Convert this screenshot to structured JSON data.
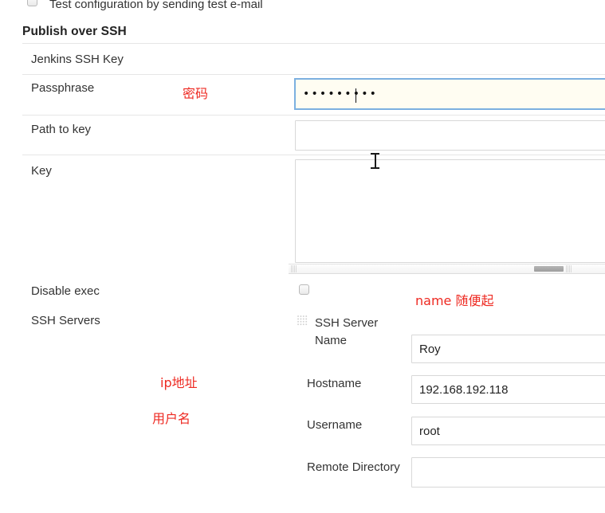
{
  "form": {
    "test_config_checkbox_label": "Test configuration by sending test e-mail",
    "section_title": "Publish over SSH",
    "fields": {
      "jenkins_ssh_key_label": "Jenkins SSH Key",
      "passphrase_label": "Passphrase",
      "passphrase_value_masked": "•••••••••",
      "path_to_key_label": "Path to key",
      "path_to_key_value": "",
      "key_label": "Key",
      "key_value": "",
      "disable_exec_label": "Disable exec",
      "ssh_servers_label": "SSH Servers"
    },
    "ssh_server": {
      "name_label": "SSH Server Name",
      "name_value": "Roy",
      "hostname_label": "Hostname",
      "hostname_value": "192.168.192.118",
      "username_label": "Username",
      "username_value": "root",
      "remote_directory_label": "Remote Directory",
      "remote_directory_value": ""
    }
  },
  "annotations": {
    "passphrase": "密码",
    "server_name": "name 随便起",
    "ip_address": "ip地址",
    "username": "用户名"
  },
  "colors": {
    "annotation_red": "#ee2a22",
    "focus_blue": "#7cb0e0",
    "label_gray": "#333333",
    "border_gray": "#d8d8d8"
  },
  "icons": {
    "drag_handle": "drag-handle-icon",
    "checkbox": "checkbox-icon",
    "text_cursor": "i-beam-cursor"
  }
}
